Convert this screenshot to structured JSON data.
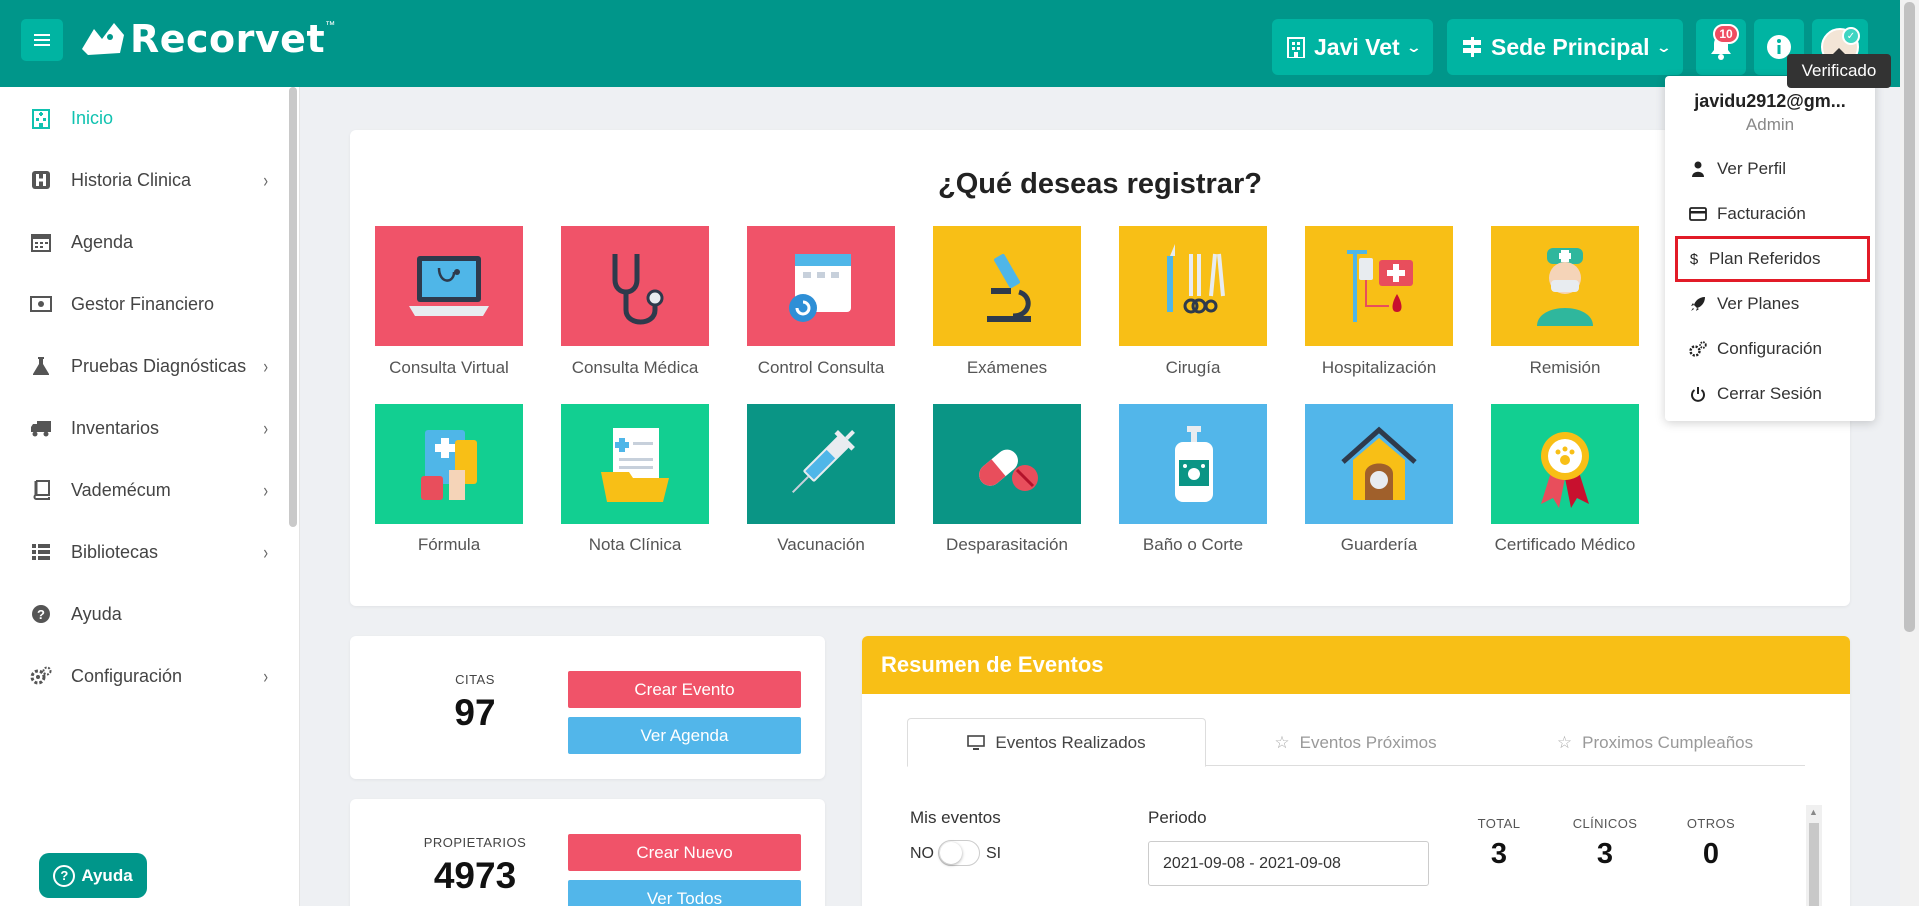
{
  "topbar": {
    "brand": "Recorvet",
    "trademark": "™",
    "clinic_label": "Javi Vet",
    "branch_label": "Sede Principal",
    "notifications_count": "10",
    "avatar_tooltip": "Verificado"
  },
  "sidebar": {
    "items": [
      {
        "label": "Inicio",
        "icon": "hospital-icon"
      },
      {
        "label": "Historia Clinica",
        "icon": "h-square-icon"
      },
      {
        "label": "Agenda",
        "icon": "calendar-icon"
      },
      {
        "label": "Gestor Financiero",
        "icon": "money-bill-icon"
      },
      {
        "label": "Pruebas Diagnósticas",
        "icon": "flask-icon"
      },
      {
        "label": "Inventarios",
        "icon": "truck-icon"
      },
      {
        "label": "Vademécum",
        "icon": "book-icon"
      },
      {
        "label": "Bibliotecas",
        "icon": "list-icon"
      },
      {
        "label": "Ayuda",
        "icon": "question-circle-icon"
      },
      {
        "label": "Configuración",
        "icon": "cogs-icon"
      }
    ],
    "help_button": "Ayuda"
  },
  "register": {
    "title": "¿Qué deseas registrar?",
    "tiles": [
      {
        "label": "Consulta Virtual",
        "color": "#f05369",
        "icon": "laptop-stethoscope-icon"
      },
      {
        "label": "Consulta Médica",
        "color": "#f05369",
        "icon": "stethoscope-icon"
      },
      {
        "label": "Control Consulta",
        "color": "#f05369",
        "icon": "calendar-stethoscope-icon"
      },
      {
        "label": "Exámenes",
        "color": "#f8bf16",
        "icon": "microscope-icon"
      },
      {
        "label": "Cirugía",
        "color": "#f8bf16",
        "icon": "surgical-tools-icon"
      },
      {
        "label": "Hospitalización",
        "color": "#f8bf16",
        "icon": "iv-drip-icon"
      },
      {
        "label": "Remisión",
        "color": "#f8bf16",
        "icon": "doctor-icon"
      },
      {
        "label": "Fórmula",
        "color": "#12cf91",
        "icon": "prescription-icon"
      },
      {
        "label": "Nota Clínica",
        "color": "#12cf91",
        "icon": "clinical-folder-icon"
      },
      {
        "label": "Vacunación",
        "color": "#0a9585",
        "icon": "syringe-icon"
      },
      {
        "label": "Desparasitación",
        "color": "#0a9585",
        "icon": "pill-icon"
      },
      {
        "label": "Baño o Corte",
        "color": "#52b6ea",
        "icon": "shampoo-icon"
      },
      {
        "label": "Guardería",
        "color": "#52b6ea",
        "icon": "dog-house-icon"
      },
      {
        "label": "Certificado Médico",
        "color": "#12cf91",
        "icon": "medal-icon"
      }
    ]
  },
  "stats": {
    "citas": {
      "label": "CITAS",
      "value": "97",
      "primary": "Crear Evento",
      "secondary": "Ver Agenda"
    },
    "propietarios": {
      "label": "PROPIETARIOS",
      "value": "4973",
      "primary": "Crear Nuevo",
      "secondary": "Ver Todos"
    }
  },
  "events": {
    "title": "Resumen de Eventos",
    "tabs": [
      "Eventos Realizados",
      "Eventos Próximos",
      "Proximos Cumpleaños"
    ],
    "my_events_label": "Mis eventos",
    "toggle_no": "NO",
    "toggle_si": "SI",
    "period_label": "Periodo",
    "period_value": "2021-09-08 - 2021-09-08",
    "totals": [
      {
        "label": "TOTAL",
        "value": "3"
      },
      {
        "label": "CLÍNICOS",
        "value": "3"
      },
      {
        "label": "OTROS",
        "value": "0"
      }
    ]
  },
  "user_menu": {
    "email": "javidu2912@gm...",
    "role": "Admin",
    "items": [
      {
        "label": "Ver Perfil",
        "icon": "user-doctor-icon"
      },
      {
        "label": "Facturación",
        "icon": "credit-card-icon"
      },
      {
        "label": "Plan Referidos",
        "icon": "dollar-icon"
      },
      {
        "label": "Ver Planes",
        "icon": "rocket-icon"
      },
      {
        "label": "Configuración",
        "icon": "cogs-icon"
      },
      {
        "label": "Cerrar Sesión",
        "icon": "power-icon"
      }
    ]
  }
}
